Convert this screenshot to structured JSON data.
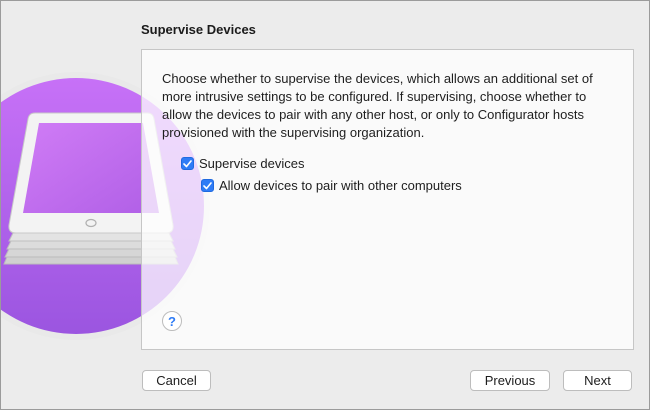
{
  "dialog": {
    "title": "Supervise Devices",
    "description": "Choose whether to supervise the devices, which allows an additional set of more intrusive settings to be configured. If supervising, choose whether to allow the devices to pair with any other host, or only to Configurator hosts provisioned with the supervising organization.",
    "options": [
      {
        "label": "Supervise devices",
        "checked": true
      },
      {
        "label": "Allow devices to pair with other computers",
        "checked": true
      }
    ],
    "help_glyph": "?"
  },
  "buttons": {
    "cancel": "Cancel",
    "previous": "Previous",
    "next": "Next"
  },
  "colors": {
    "accent": "#2f7cf6",
    "illustration_purple": "#b45ff0"
  },
  "icons": {
    "illustration": "stacked-tablets-icon",
    "help": "help-icon",
    "checkmark": "checkmark-icon"
  }
}
